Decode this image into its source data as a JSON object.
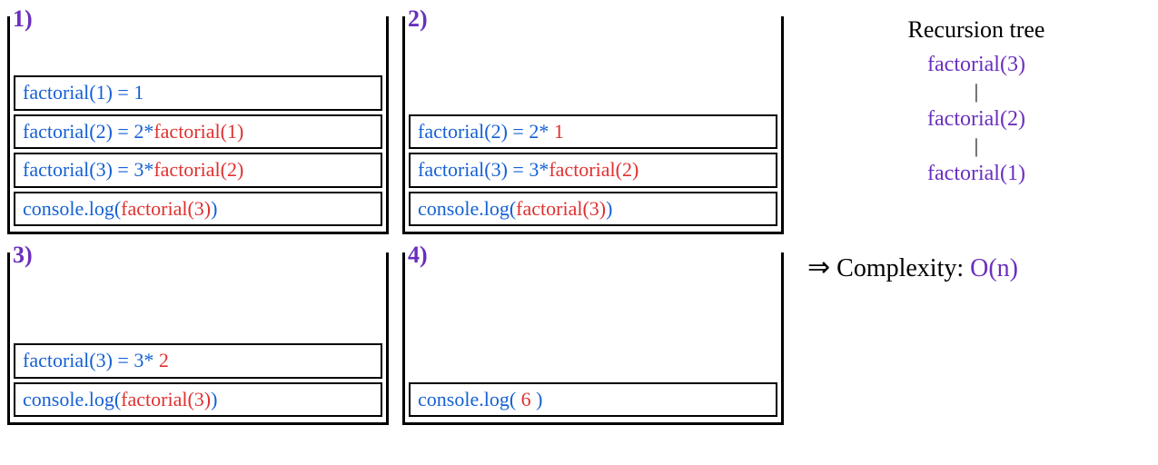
{
  "stacks": [
    {
      "label": "1)",
      "frames": [
        [
          {
            "t": "factorial(1) = ",
            "c": "blue"
          },
          {
            "t": "1",
            "c": "blue"
          }
        ],
        [
          {
            "t": "factorial(2) = 2*",
            "c": "blue"
          },
          {
            "t": "factorial(1)",
            "c": "red"
          }
        ],
        [
          {
            "t": "factorial(3) = 3*",
            "c": "blue"
          },
          {
            "t": "factorial(2)",
            "c": "red"
          }
        ],
        [
          {
            "t": "console.log(",
            "c": "blue"
          },
          {
            "t": "factorial(3)",
            "c": "red"
          },
          {
            "t": ")",
            "c": "blue"
          }
        ]
      ]
    },
    {
      "label": "2)",
      "frames": [
        [
          {
            "t": "factorial(2) = 2* ",
            "c": "blue"
          },
          {
            "t": " 1",
            "c": "red"
          }
        ],
        [
          {
            "t": "factorial(3) = 3*",
            "c": "blue"
          },
          {
            "t": "factorial(2)",
            "c": "red"
          }
        ],
        [
          {
            "t": "console.log(",
            "c": "blue"
          },
          {
            "t": "factorial(3)",
            "c": "red"
          },
          {
            "t": ")",
            "c": "blue"
          }
        ]
      ]
    },
    {
      "label": "3)",
      "frames": [
        [
          {
            "t": "factorial(3) = 3* ",
            "c": "blue"
          },
          {
            "t": "2",
            "c": "red"
          }
        ],
        [
          {
            "t": "console.log(",
            "c": "blue"
          },
          {
            "t": "factorial(3)",
            "c": "red"
          },
          {
            "t": ")",
            "c": "blue"
          }
        ]
      ]
    },
    {
      "label": "4)",
      "frames": [
        [
          {
            "t": "console.log(   ",
            "c": "blue"
          },
          {
            "t": "6",
            "c": "red"
          },
          {
            "t": "   )",
            "c": "blue"
          }
        ]
      ]
    }
  ],
  "tree": {
    "title": "Recursion tree",
    "nodes": [
      "factorial(3)",
      "|",
      "factorial(2)",
      "|",
      "factorial(1)"
    ]
  },
  "complexity": {
    "arrow": "⇒",
    "label": "Complexity:",
    "value": "O(n)"
  }
}
